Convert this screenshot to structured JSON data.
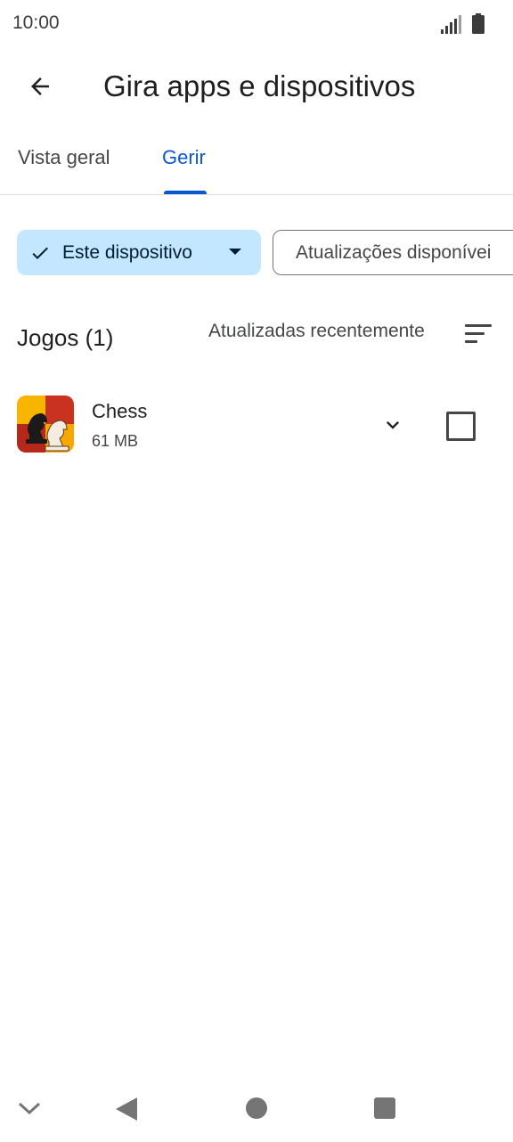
{
  "status_bar": {
    "time": "10:00",
    "icons": [
      "signal-icon",
      "battery-icon"
    ]
  },
  "header": {
    "back_icon": "arrow-back-icon",
    "title": "Gira apps e dispositivos"
  },
  "tabs": [
    {
      "label": "Vista geral",
      "selected": false
    },
    {
      "label": "Gerir",
      "selected": true
    }
  ],
  "filters": {
    "device_chip": {
      "label": "Este dispositivo",
      "selected": true,
      "icon": "check-icon",
      "dropdown_icon": "dropdown-arrow-icon"
    },
    "updates_chip": {
      "label": "Atualizações disponívei",
      "selected": false
    }
  },
  "section": {
    "title": "Jogos (1)",
    "sort_label": "Atualizadas recentemente",
    "sort_icon": "sort-icon"
  },
  "apps": [
    {
      "name": "Chess",
      "size": "61 MB",
      "icon": "chess-app-icon",
      "checked": false
    }
  ],
  "nav_bar": {
    "icons": [
      "collapse-icon",
      "back-triangle-icon",
      "home-circle-icon",
      "recents-square-icon"
    ]
  },
  "colors": {
    "accent": "#0b57d0",
    "chip_selected_bg": "#c2e7ff",
    "text_primary": "#1f1f1f",
    "text_secondary": "#444746"
  }
}
